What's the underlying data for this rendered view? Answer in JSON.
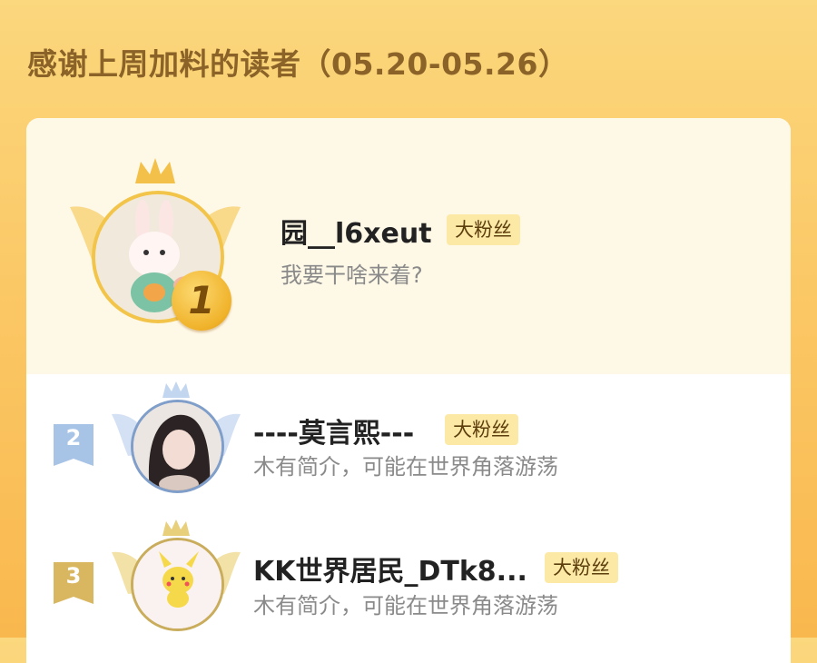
{
  "header": {
    "title": "感谢上周加料的读者（05.20-05.26）"
  },
  "readers": [
    {
      "rank": "1",
      "name": "园__l6xeut",
      "tag": "大粉丝",
      "bio": "我要干啥来着?"
    },
    {
      "rank": "2",
      "name": "----莫言熙---",
      "tag": "大粉丝",
      "bio": "木有简介，可能在世界角落游荡"
    },
    {
      "rank": "3",
      "name": "KK世界居民_DTk8...",
      "tag": "大粉丝",
      "bio": "木有简介，可能在世界角落游荡"
    }
  ],
  "colors": {
    "gold": "#f0b22a",
    "silver": "#9fbde0",
    "bronze": "#d6b45a",
    "tag_bg": "#fde9a6"
  }
}
